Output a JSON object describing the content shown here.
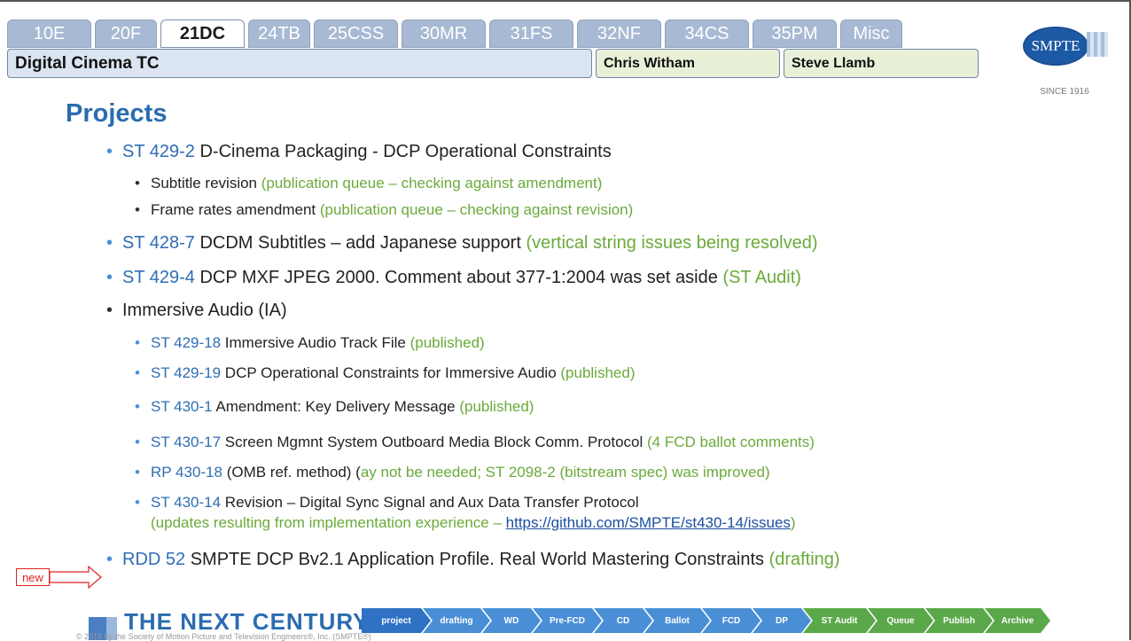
{
  "tabs": [
    {
      "label": "10E",
      "active": false
    },
    {
      "label": "20F",
      "active": false
    },
    {
      "label": "21DC",
      "active": true
    },
    {
      "label": "24TB",
      "active": false
    },
    {
      "label": "25CSS",
      "active": false
    },
    {
      "label": "30MR",
      "active": false
    },
    {
      "label": "31FS",
      "active": false
    },
    {
      "label": "32NF",
      "active": false
    },
    {
      "label": "34CS",
      "active": false
    },
    {
      "label": "35PM",
      "active": false
    },
    {
      "label": "Misc",
      "active": false
    }
  ],
  "titlebar": {
    "committee": "Digital Cinema TC",
    "chair1": "Chris Witham",
    "chair2": "Steve Llamb"
  },
  "logo": {
    "text": "SMPTE",
    "since": "SINCE 1916"
  },
  "heading": "Projects",
  "items": [
    {
      "ref": "ST 429-2",
      "desc": " D-Cinema Packaging - DCP Operational Constraints",
      "status": ""
    },
    {
      "ref": "",
      "desc": "Subtitle revision ",
      "status": "(publication queue – checking against amendment)"
    },
    {
      "ref": "",
      "desc": "Frame rates amendment ",
      "status": "(publication queue – checking against revision)"
    },
    {
      "ref": "ST 428-7",
      "desc": " DCDM Subtitles – add Japanese support ",
      "status": "(vertical string issues being resolved)"
    },
    {
      "ref": "ST 429-4",
      "desc": " DCP MXF JPEG 2000. Comment about 377-1:2004 was set aside ",
      "status": "(ST Audit)"
    },
    {
      "ref": "",
      "desc": "Immersive Audio (IA)",
      "status": ""
    },
    {
      "ref": "ST 429-18",
      "desc": " Immersive Audio Track File ",
      "status": "(published)"
    },
    {
      "ref": "ST 429-19",
      "desc": " DCP Operational Constraints for Immersive Audio ",
      "status": "(published)"
    },
    {
      "ref": "ST 430-1",
      "desc": " Amendment: Key Delivery Message ",
      "status": "(published)"
    },
    {
      "ref": "ST 430-17",
      "desc": " Screen Mgmnt System Outboard Media Block Comm. Protocol ",
      "status": "(4 FCD ballot comments)"
    },
    {
      "ref": "RP 430-18",
      "desc": " (OMB ref. method) (",
      "status": "ay not be needed; ST 2098-2 (bitstream spec) was improved)"
    },
    {
      "ref": "ST 430-14",
      "desc": " Revision – Digital Sync Signal and Aux Data Transfer Protocol",
      "status": ""
    },
    {
      "ref": "",
      "desc": "",
      "status": "(updates resulting from implementation experience – ",
      "link": "https://github.com/SMPTE/st430-14/issues",
      "status_end": ")"
    },
    {
      "ref": "RDD 52",
      "desc": " SMPTE DCP Bv2.1 Application Profile. Real World Mastering Constraints ",
      "status": "(drafting)"
    }
  ],
  "new_marker": "new",
  "footer": {
    "title": "THE NEXT CENTURY",
    "copyright": "© 2019 by the Society of Motion Picture and Television Engineers®, Inc. (SMPTE®)"
  },
  "workflow": [
    "project",
    "drafting",
    "WD",
    "Pre-FCD",
    "CD",
    "Ballot",
    "FCD",
    "DP",
    "ST Audit",
    "Queue",
    "Publish",
    "Archive"
  ],
  "colors": {
    "accent": "#2b6cb0",
    "status": "#6aaa3a",
    "tab": "#a8b9d3"
  }
}
